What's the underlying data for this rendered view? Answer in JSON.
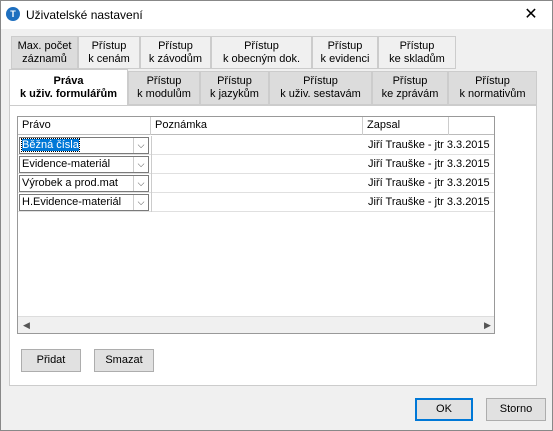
{
  "window": {
    "title": "Uživatelské nastavení",
    "icon_letter": "T",
    "close_symbol": "✕"
  },
  "tabs_row1": [
    {
      "label": "Max. počet\nzáznamů"
    },
    {
      "label": "Přístup\nk cenám"
    },
    {
      "label": "Přístup\nk závodům"
    },
    {
      "label": "Přístup\nk obecným dok."
    },
    {
      "label": "Přístup\nk evidenci"
    },
    {
      "label": "Přístup\nke skladům"
    }
  ],
  "tabs_row2": [
    {
      "label": "Práva\nk uživ. formulářům",
      "active": true
    },
    {
      "label": "Přístup\nk modulům"
    },
    {
      "label": "Přístup\nk jazykům"
    },
    {
      "label": "Přístup\nk uživ. sestavám"
    },
    {
      "label": "Přístup\nke zprávám"
    },
    {
      "label": "Přístup\nk normativům"
    }
  ],
  "grid": {
    "columns": [
      "Právo",
      "Poznámka",
      "Zapsal"
    ],
    "rows": [
      {
        "pravo": "Běžná čísla",
        "poznamka": "",
        "zapsal": "Jiří Trauške - jtr 3.3.2015"
      },
      {
        "pravo": "Evidence-materiál",
        "poznamka": "",
        "zapsal": "Jiří Trauške - jtr 3.3.2015"
      },
      {
        "pravo": "Výrobek a prod.mat",
        "poznamka": "",
        "zapsal": "Jiří Trauške - jtr 3.3.2015"
      },
      {
        "pravo": "H.Evidence-materiál",
        "poznamka": "",
        "zapsal": "Jiří Trauške - jtr 3.3.2015"
      }
    ],
    "selected_row": 0
  },
  "buttons": {
    "add": "Přidat",
    "delete": "Smazat",
    "ok": "OK",
    "cancel": "Storno"
  },
  "icons": {
    "combo_arrow": "chevron-down-icon",
    "scroll_left": "arrow-left-icon",
    "scroll_right": "arrow-right-icon"
  }
}
